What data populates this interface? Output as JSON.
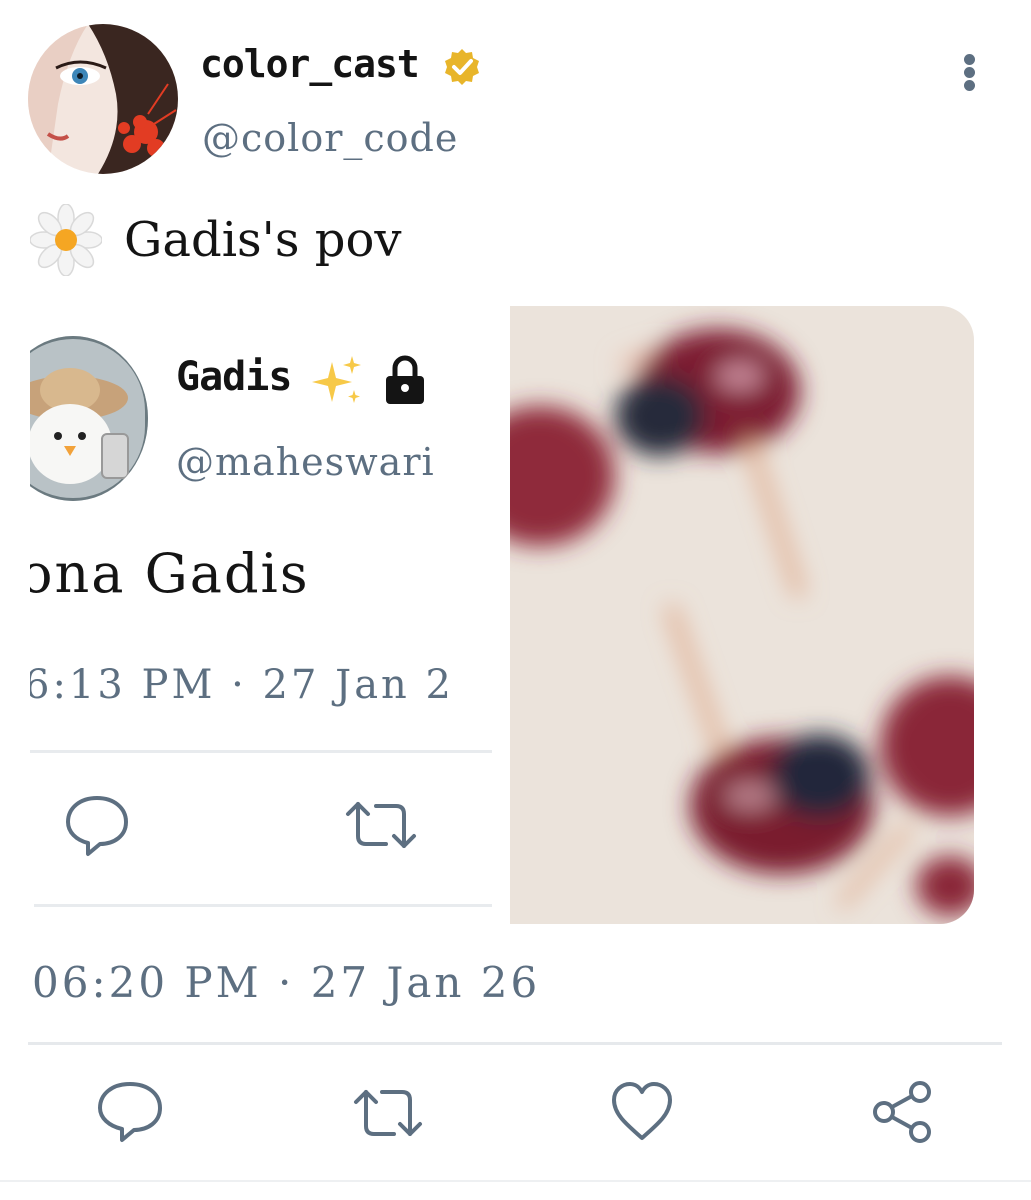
{
  "author": {
    "display_name": "color_cast",
    "handle": "@color_code",
    "verified": true
  },
  "tweet": {
    "emoji_icon": "daisy-emoji",
    "text": "Gadis's pov",
    "timestamp": "06:20 PM · 27 Jan 26"
  },
  "quoted_tweet": {
    "display_name": "Gadis",
    "name_emoji": "sparkles-emoji",
    "locked": true,
    "handle": "@maheswari",
    "text": "ona Gadis",
    "timestamp": "6:13 PM · 27 Jan 2"
  },
  "actions": [
    "reply-icon",
    "retweet-icon",
    "like-icon",
    "share-icon"
  ],
  "colors": {
    "text_primary": "#141414",
    "text_secondary": "#5d6f81",
    "divider": "#e6e9ec",
    "verified_badge": "#e8b52a"
  }
}
